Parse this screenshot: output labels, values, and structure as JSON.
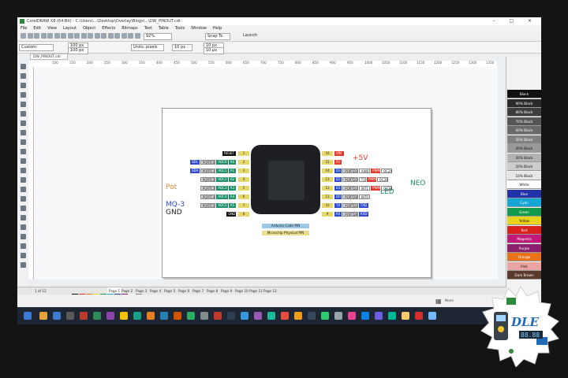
{
  "window": {
    "title": "CorelDRAW X8 (64-Bit) - C:\\Users\\...\\Desktop\\Overlay\\Blogs\\...\\DW_PINOUT.cdr"
  },
  "menu": [
    "File",
    "Edit",
    "View",
    "Layout",
    "Object",
    "Effects",
    "Bitmaps",
    "Text",
    "Table",
    "Tools",
    "Window",
    "Help"
  ],
  "toolbar": {
    "zoom": "92%",
    "snap_to": "Snap To",
    "launch": "Launch",
    "width": "100 px",
    "height": "100 px",
    "units": "Units: pixels",
    "nudge": "10 px",
    "dup_x": "10 px",
    "dup_y": "10 px",
    "paper": "Custom"
  },
  "doc_tab": "DW_PINOUT.cdr",
  "ruler_ticks": [
    "100",
    "150",
    "200",
    "250",
    "300",
    "350",
    "400",
    "450",
    "500",
    "550",
    "600",
    "650",
    "700",
    "750",
    "800",
    "850",
    "900",
    "950",
    "1000",
    "1050",
    "1100",
    "1150",
    "1200",
    "1250",
    "1300",
    "1350"
  ],
  "diagram": {
    "labels": {
      "plus5v": "+5V",
      "neo": "NEO",
      "led": "LED",
      "pot": "Pot",
      "mq3": "MQ-3",
      "gnd": "GND"
    },
    "left": [
      {
        "num": "1",
        "tags": [
          {
            "t": "RESET",
            "c": "black"
          }
        ]
      },
      {
        "num": "2",
        "tags": [
          {
            "t": "A0",
            "c": "green"
          },
          {
            "t": "ADC0",
            "c": "green"
          },
          {
            "t": "PORTC0",
            "c": "grey"
          },
          {
            "t": "SDL",
            "c": "blue"
          }
        ]
      },
      {
        "num": "3",
        "tags": [
          {
            "t": "A1",
            "c": "green"
          },
          {
            "t": "ADC1",
            "c": "green"
          },
          {
            "t": "PORTC1",
            "c": "grey"
          },
          {
            "t": "SDA",
            "c": "blue"
          }
        ]
      },
      {
        "num": "4",
        "tags": [
          {
            "t": "A2",
            "c": "green"
          },
          {
            "t": "ADC2",
            "c": "green"
          },
          {
            "t": "PORTC2",
            "c": "grey"
          }
        ]
      },
      {
        "num": "5",
        "tags": [
          {
            "t": "A3",
            "c": "green"
          },
          {
            "t": "ADC3",
            "c": "green"
          },
          {
            "t": "PORTC3",
            "c": "grey"
          }
        ]
      },
      {
        "num": "6",
        "tags": [
          {
            "t": "A4",
            "c": "green"
          },
          {
            "t": "ADC4",
            "c": "green"
          },
          {
            "t": "PORTC4",
            "c": "grey"
          }
        ]
      },
      {
        "num": "7",
        "tags": [
          {
            "t": "A5",
            "c": "green"
          },
          {
            "t": "ADC5",
            "c": "green"
          },
          {
            "t": "PORTC5",
            "c": "grey"
          }
        ]
      },
      {
        "num": "8",
        "tags": [
          {
            "t": "GND",
            "c": "black"
          }
        ]
      }
    ],
    "right": [
      {
        "num": "16",
        "tags": [
          {
            "t": "VIN",
            "c": "red"
          }
        ]
      },
      {
        "num": "15",
        "tags": [
          {
            "t": "5V",
            "c": "red"
          }
        ]
      },
      {
        "num": "14",
        "tags": [
          {
            "t": "D3",
            "c": "blue"
          },
          {
            "t": "PORTD3",
            "c": "grey"
          },
          {
            "t": "AIN0",
            "c": "white"
          },
          {
            "t": "PWM",
            "c": "red"
          },
          {
            "t": "OC2A",
            "c": "white"
          }
        ]
      },
      {
        "num": "13",
        "tags": [
          {
            "t": "D2",
            "c": "blue"
          },
          {
            "t": "PORTD2",
            "c": "grey"
          },
          {
            "t": "T1",
            "c": "white"
          },
          {
            "t": "PWM",
            "c": "red"
          },
          {
            "t": "OC2B",
            "c": "white"
          }
        ]
      },
      {
        "num": "12",
        "tags": [
          {
            "t": "D1",
            "c": "blue"
          },
          {
            "t": "PORTD1",
            "c": "grey"
          },
          {
            "t": "INT1",
            "c": "white"
          },
          {
            "t": "PWM",
            "c": "red"
          },
          {
            "t": "OC2B",
            "c": "white"
          }
        ]
      },
      {
        "num": "11",
        "tags": [
          {
            "t": "D0",
            "c": "blue"
          },
          {
            "t": "PORTD0",
            "c": "grey"
          },
          {
            "t": "INT0",
            "c": "white"
          }
        ]
      },
      {
        "num": "10",
        "tags": [
          {
            "t": "TX",
            "c": "blue"
          },
          {
            "t": "PORTD1",
            "c": "grey"
          },
          {
            "t": "TXD",
            "c": "blue"
          }
        ]
      },
      {
        "num": "9",
        "tags": [
          {
            "t": "RX",
            "c": "blue"
          },
          {
            "t": "PORTD0",
            "c": "grey"
          },
          {
            "t": "RXD",
            "c": "blue"
          }
        ]
      }
    ],
    "legend": [
      {
        "text": "Arduino Code PIN",
        "color": "#9cc9e8"
      },
      {
        "text": "Microchip Physical PIN",
        "color": "#e8e08a"
      }
    ]
  },
  "palette": [
    {
      "name": "Black",
      "bg": "#111111",
      "fg": "#ffffff"
    },
    {
      "name": "90% Black",
      "bg": "#2a2a2a",
      "fg": "#ffffff"
    },
    {
      "name": "80% Black",
      "bg": "#3d3d3d",
      "fg": "#ffffff"
    },
    {
      "name": "70% Black",
      "bg": "#555555",
      "fg": "#ffffff"
    },
    {
      "name": "60% Black",
      "bg": "#6a6a6a",
      "fg": "#ffffff"
    },
    {
      "name": "50% Black",
      "bg": "#808080",
      "fg": "#ffffff"
    },
    {
      "name": "40% Black",
      "bg": "#999999",
      "fg": "#111111"
    },
    {
      "name": "30% Black",
      "bg": "#b3b3b3",
      "fg": "#111111"
    },
    {
      "name": "20% Black",
      "bg": "#cccccc",
      "fg": "#111111"
    },
    {
      "name": "10% Black",
      "bg": "#e6e6e6",
      "fg": "#111111"
    },
    {
      "name": "White",
      "bg": "#ffffff",
      "fg": "#111111"
    },
    {
      "name": "Blue",
      "bg": "#2233aa",
      "fg": "#ffffff"
    },
    {
      "name": "Cyan",
      "bg": "#15a6d6",
      "fg": "#ffffff"
    },
    {
      "name": "Green",
      "bg": "#149a4c",
      "fg": "#ffffff"
    },
    {
      "name": "Yellow",
      "bg": "#e8d21a",
      "fg": "#111111"
    },
    {
      "name": "Red",
      "bg": "#d9211e",
      "fg": "#ffffff"
    },
    {
      "name": "Magenta",
      "bg": "#c2187a",
      "fg": "#ffffff"
    },
    {
      "name": "Purple",
      "bg": "#8a1f6e",
      "fg": "#ffffff"
    },
    {
      "name": "Orange",
      "bg": "#e8731a",
      "fg": "#ffffff"
    },
    {
      "name": "Pink",
      "bg": "#e9a3a0",
      "fg": "#111111"
    },
    {
      "name": "Dark Brown",
      "bg": "#5a3a2a",
      "fg": "#ffffff"
    }
  ],
  "page_tabs": [
    "Page 1",
    "Page 2",
    "Page 3",
    "Page 4",
    "Page 5",
    "Page 6",
    "Page 7",
    "Page 8",
    "Page 9",
    "Page 10",
    "Page 11",
    "Page 12"
  ],
  "page_counter": "1 of 12",
  "status": {
    "fill": "None"
  },
  "watermark": {
    "text": "DLE",
    "seg": "88.88"
  }
}
